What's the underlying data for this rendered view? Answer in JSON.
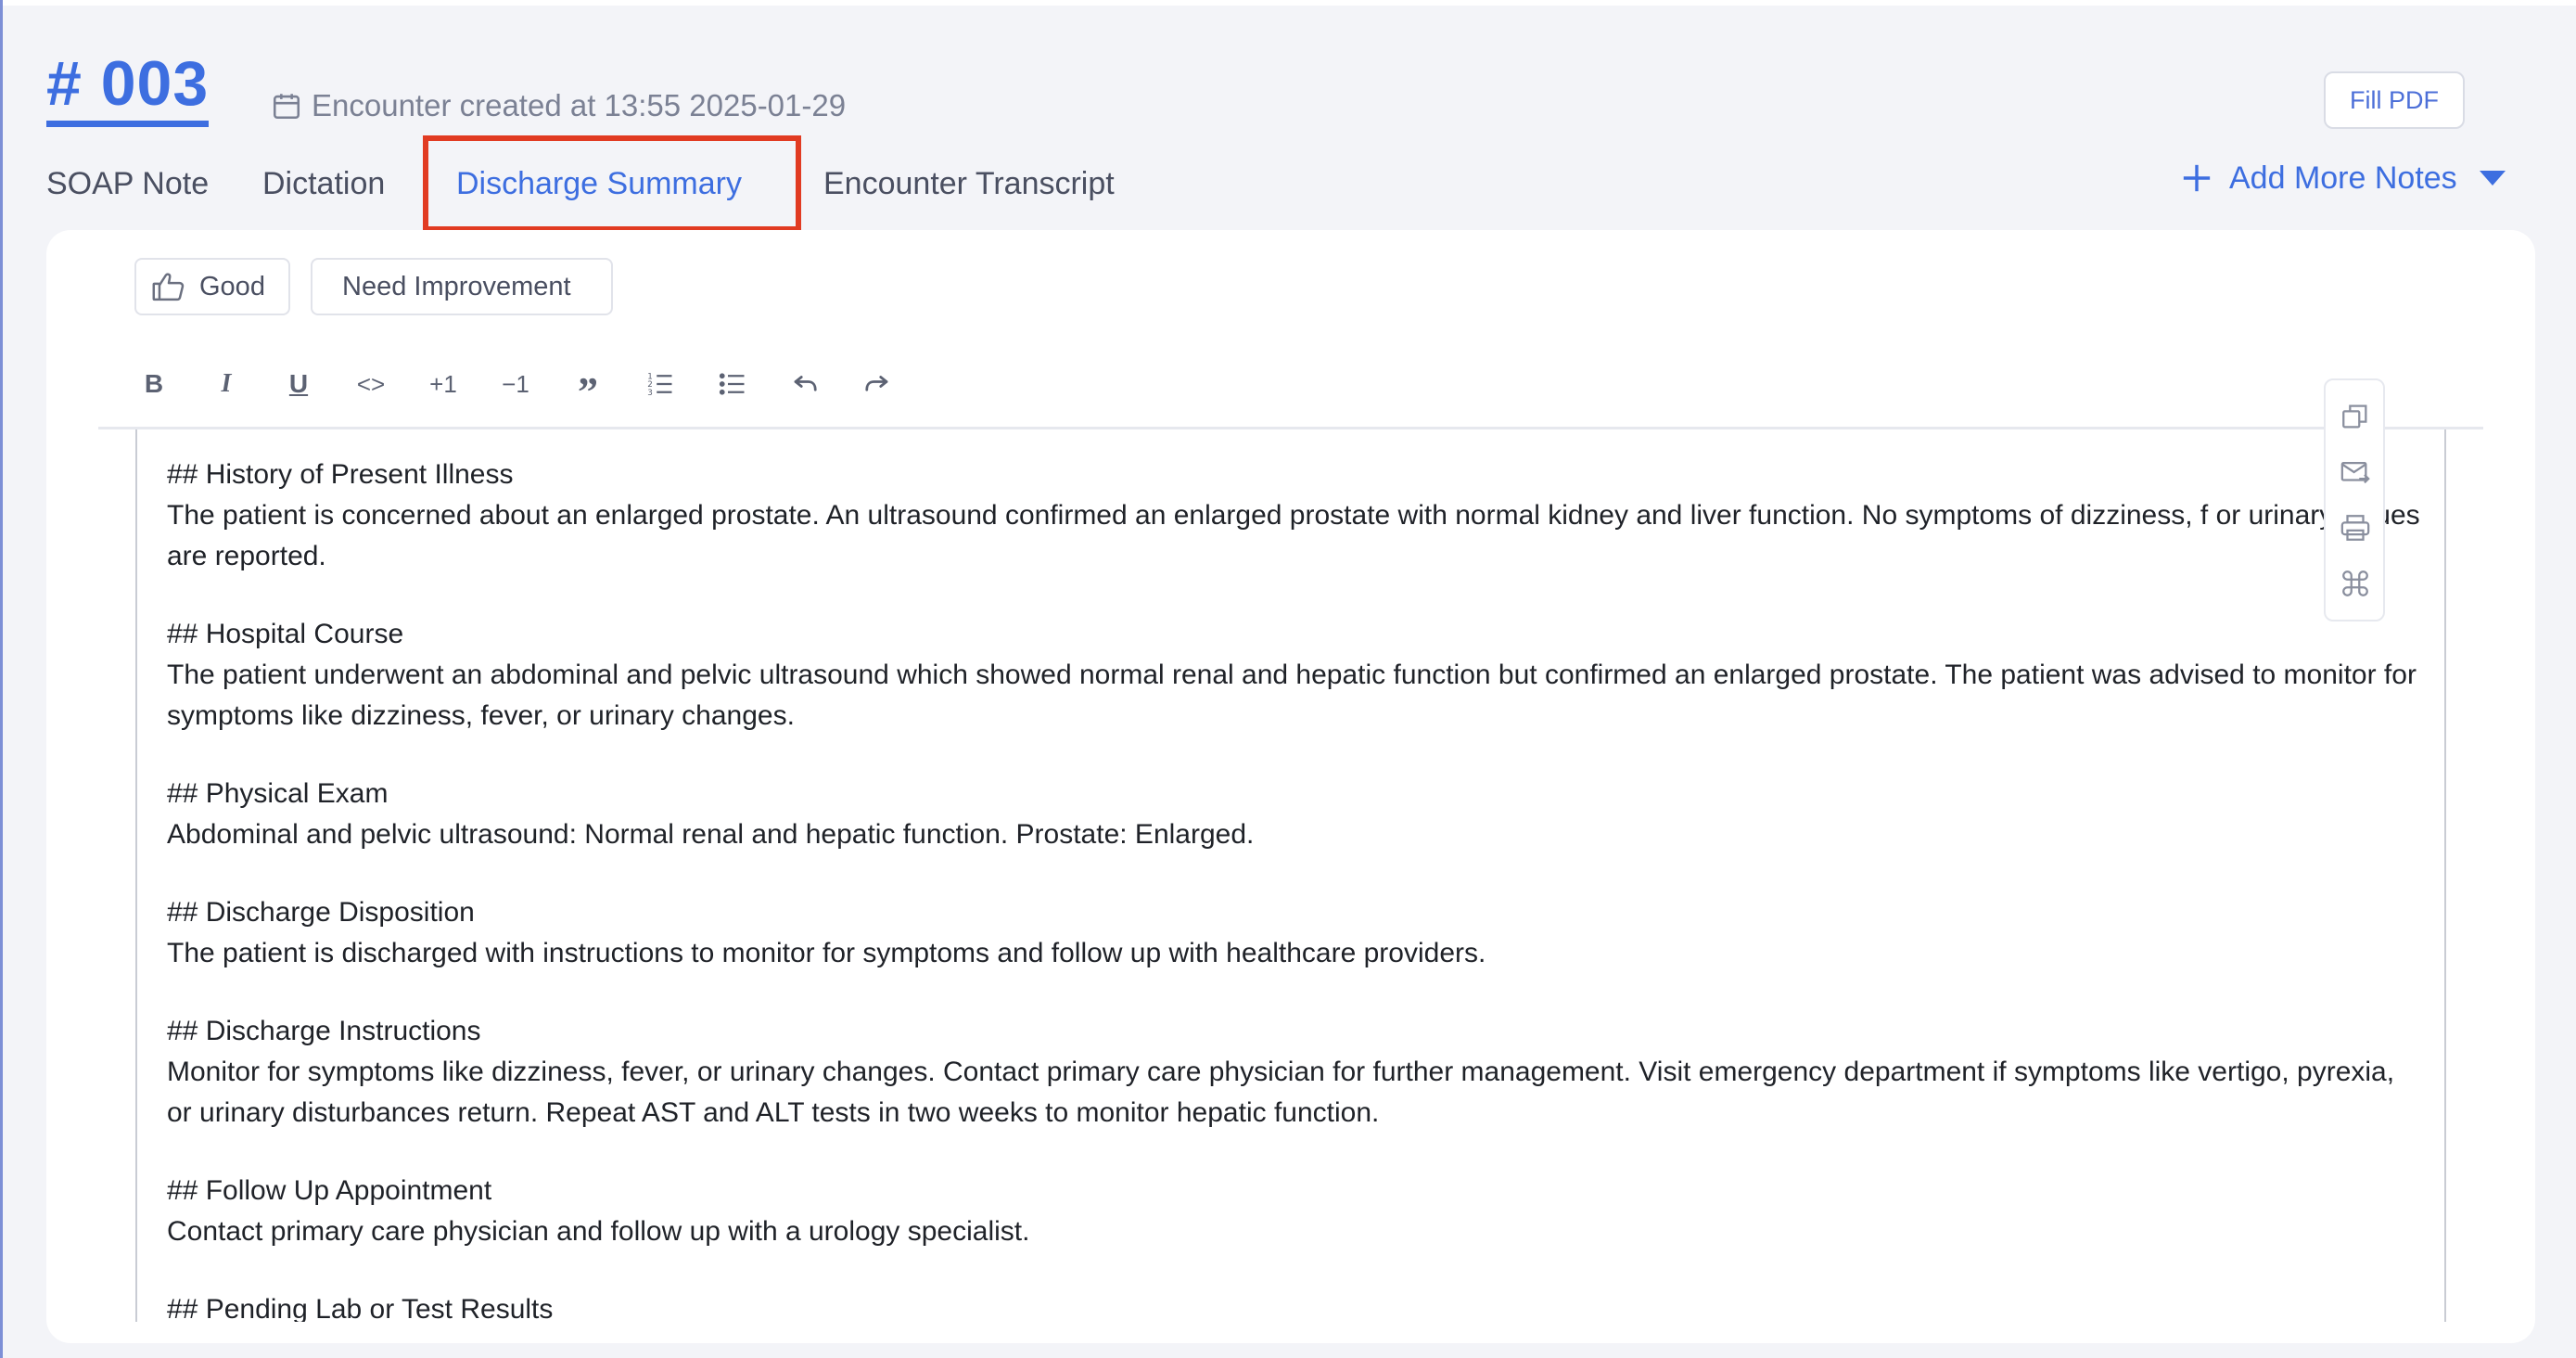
{
  "encounter": {
    "number": "# 003",
    "created": "Encounter created at 13:55 2025-01-29"
  },
  "actions": {
    "fill_pdf": "Fill PDF",
    "add_more_notes": "Add More Notes"
  },
  "tabs": [
    {
      "label": "SOAP Note"
    },
    {
      "label": "Dictation"
    },
    {
      "label": "Discharge Summary",
      "active": true
    },
    {
      "label": "Encounter Transcript"
    }
  ],
  "feedback": {
    "good": "Good",
    "need_improvement": "Need Improvement"
  },
  "toolbar": {
    "bold": "B",
    "italic": "I",
    "underline": "U",
    "code": "<>",
    "increase_indent": "+1",
    "decrease_indent": "−1",
    "quote": "”",
    "ordered_list": "ordered-list-icon",
    "bullet_list": "bullet-list-icon",
    "undo": "undo-icon",
    "redo": "redo-icon"
  },
  "side_tools": [
    "copy-icon",
    "email-icon",
    "print-icon",
    "command-icon"
  ],
  "document": {
    "sections": [
      {
        "heading": "## History of Present Illness",
        "body": "The patient is concerned about an enlarged prostate. An ultrasound confirmed an enlarged prostate with normal kidney and liver function. No symptoms of dizziness, f or urinary issues are reported."
      },
      {
        "heading": "## Hospital Course",
        "body": "The patient underwent an abdominal and pelvic ultrasound which showed normal renal and hepatic function but confirmed an enlarged prostate. The patient was advised to monitor for symptoms like dizziness, fever, or urinary changes."
      },
      {
        "heading": "## Physical Exam",
        "body": "Abdominal and pelvic ultrasound: Normal renal and hepatic function. Prostate: Enlarged."
      },
      {
        "heading": "## Discharge Disposition",
        "body": "The patient is discharged with instructions to monitor for symptoms and follow up with healthcare providers."
      },
      {
        "heading": "## Discharge Instructions",
        "body": "Monitor for symptoms like dizziness, fever, or urinary changes. Contact primary care physician for further management. Visit emergency department if symptoms like vertigo, pyrexia, or urinary disturbances return. Repeat AST and ALT tests in two weeks to monitor hepatic function."
      },
      {
        "heading": "## Follow Up Appointment",
        "body": "Contact primary care physician and follow up with a urology specialist."
      },
      {
        "heading": "## Pending Lab or Test Results",
        "body": ""
      }
    ]
  },
  "colors": {
    "accent": "#3d6ee0",
    "highlight": "#e13b22",
    "background": "#f3f4f8"
  }
}
